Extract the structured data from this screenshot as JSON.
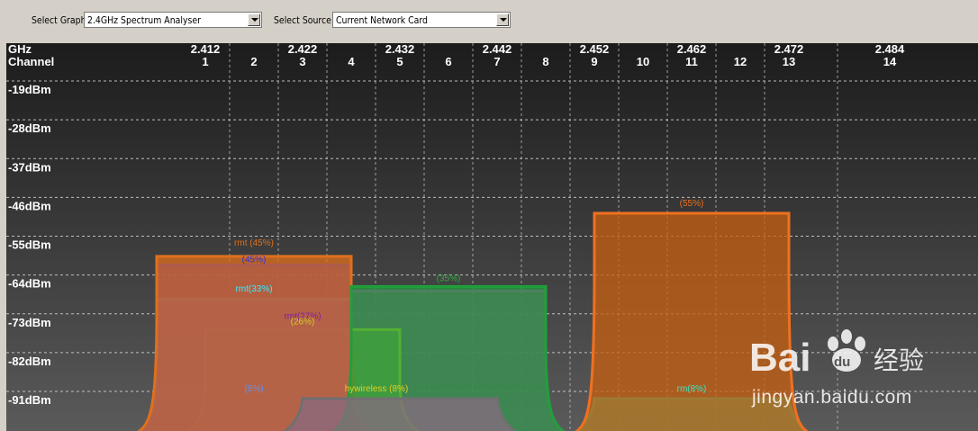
{
  "toolbar": {
    "select_graph_label": "Select Graph",
    "select_graph_value": "2.4GHz Spectrum Analyser",
    "select_source_label": "Select Source",
    "select_source_value": "Current Network Card"
  },
  "graph": {
    "ghz_label": "GHz",
    "channel_label": "Channel",
    "background_top": "#1c1c1c",
    "background_bottom": "#5a5a5a",
    "ghz_ticks": [
      {
        "text": "2.412",
        "ch": 1
      },
      {
        "text": "2.422",
        "ch": 3
      },
      {
        "text": "2.432",
        "ch": 5
      },
      {
        "text": "2.442",
        "ch": 7
      },
      {
        "text": "2.452",
        "ch": 9
      },
      {
        "text": "2.462",
        "ch": 11
      },
      {
        "text": "2.472",
        "ch": 13
      },
      {
        "text": "2.484",
        "ch": 14
      }
    ],
    "channels": [
      "1",
      "2",
      "3",
      "4",
      "5",
      "6",
      "7",
      "8",
      "9",
      "10",
      "11",
      "12",
      "13",
      "14"
    ],
    "dbm_labels": [
      "-19dBm",
      "-28dBm",
      "-37dBm",
      "-46dBm",
      "-55dBm",
      "-64dBm",
      "-73dBm",
      "-82dBm",
      "-91dBm"
    ],
    "dbm_values": [
      -19,
      -28,
      -37,
      -46,
      -55,
      -64,
      -73,
      -82,
      -91
    ]
  },
  "networks": [
    {
      "label": "rmt (45%)",
      "center": 2,
      "dbm": -58,
      "color": "#e0701c",
      "fill": "#e0701c",
      "label_color": "#e0701c"
    },
    {
      "label": "(45%)",
      "center": 2,
      "dbm": -60,
      "color": "#1e1ed8",
      "fill": "#2a20c8",
      "label_color": "#3030e0"
    },
    {
      "label": "rmt(33%)",
      "center": 2,
      "dbm": -68,
      "color": "#40e8ff",
      "fill": "#4a90f0",
      "label_color": "#40e8ff"
    },
    {
      "label": "(35%)",
      "center": 6,
      "dbm": -65,
      "color": "#1fa03a",
      "fill": "#1fa03a",
      "label_color": "#2ab040"
    },
    {
      "label": "",
      "center": 6,
      "dbm": -66,
      "color": "#e020e0",
      "fill": "#b030b0",
      "label_color": "#e020e0"
    },
    {
      "label": "rmt(27%)",
      "center": 3,
      "dbm": -75,
      "color": "#f0e020",
      "fill": "#a09050",
      "label_color": "#8020a0"
    },
    {
      "label": "(26%)",
      "center": 3,
      "dbm": -75,
      "color": "#f0e020",
      "fill": "#a09050",
      "label_color": "#d0d020"
    },
    {
      "label": "(55%)",
      "center": 11,
      "dbm": -48,
      "color": "#f07020",
      "fill": "#c86010",
      "label_color": "#f07020"
    },
    {
      "label": "(8%)",
      "center": 2,
      "dbm": -91,
      "color": "#2060e0",
      "fill": "#2050a0",
      "label_color": "#6090f0"
    },
    {
      "label": "hywireless (8%)",
      "center": 5,
      "dbm": -91,
      "color": "#707070",
      "fill": "#8a6a80",
      "label_color": "#e0d020"
    },
    {
      "label": "rm(8%)",
      "center": 11,
      "dbm": -91,
      "color": "#20c8a0",
      "fill": "#20c8a0",
      "label_color": "#40e0c0"
    }
  ],
  "watermark": {
    "brand": "Bai du 经验",
    "url": "jingyan.baidu.com"
  }
}
